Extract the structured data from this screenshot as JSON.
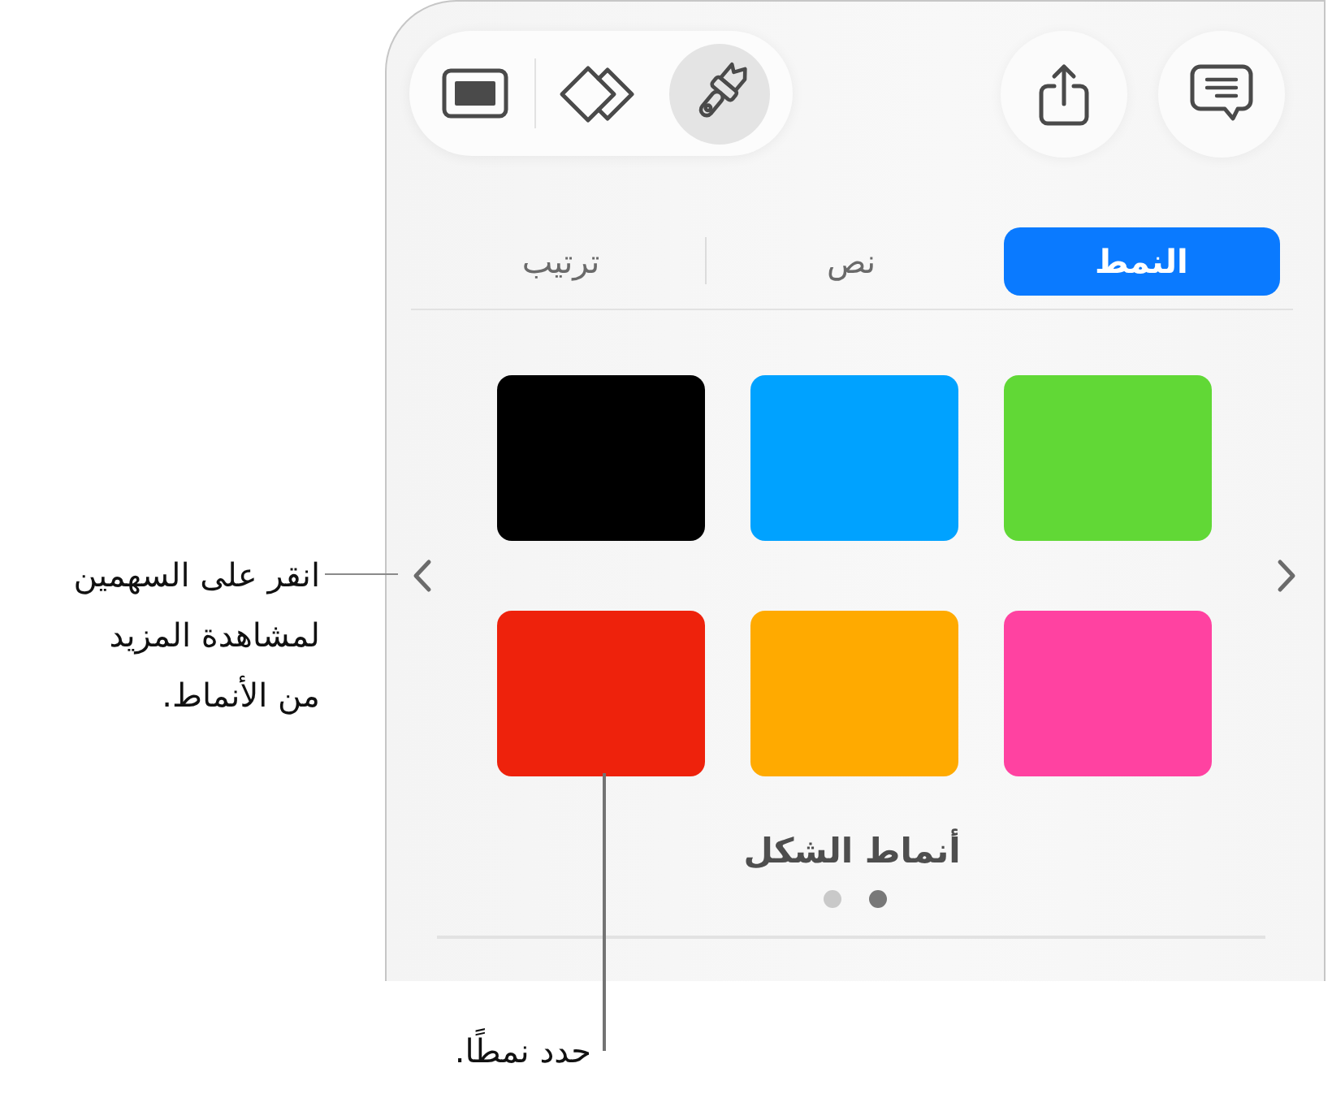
{
  "toolbar": {
    "tools": [
      {
        "kind": "frame",
        "selected": false
      },
      {
        "kind": "stack",
        "selected": false
      },
      {
        "kind": "brush",
        "selected": true
      }
    ],
    "actions": [
      {
        "kind": "share"
      },
      {
        "kind": "comment"
      }
    ]
  },
  "tabs": [
    {
      "label": "النمط",
      "selected": true
    },
    {
      "label": "نص",
      "selected": false
    },
    {
      "label": "ترتيب",
      "selected": false
    }
  ],
  "styles": {
    "swatches": [
      {
        "color": "#61d836"
      },
      {
        "color": "#00a2ff"
      },
      {
        "color": "#000000"
      },
      {
        "color": "#ff42a1"
      },
      {
        "color": "#ffaa00"
      },
      {
        "color": "#ee220c"
      }
    ],
    "title": "أنماط الشكل",
    "pages": [
      {
        "selected": true
      },
      {
        "selected": false
      }
    ]
  },
  "callouts": [
    {
      "text": "انقر على السهمين\nلمشاهدة المزيد\nمن الأنماط."
    },
    {
      "text": "حدد نمطًا."
    }
  ]
}
